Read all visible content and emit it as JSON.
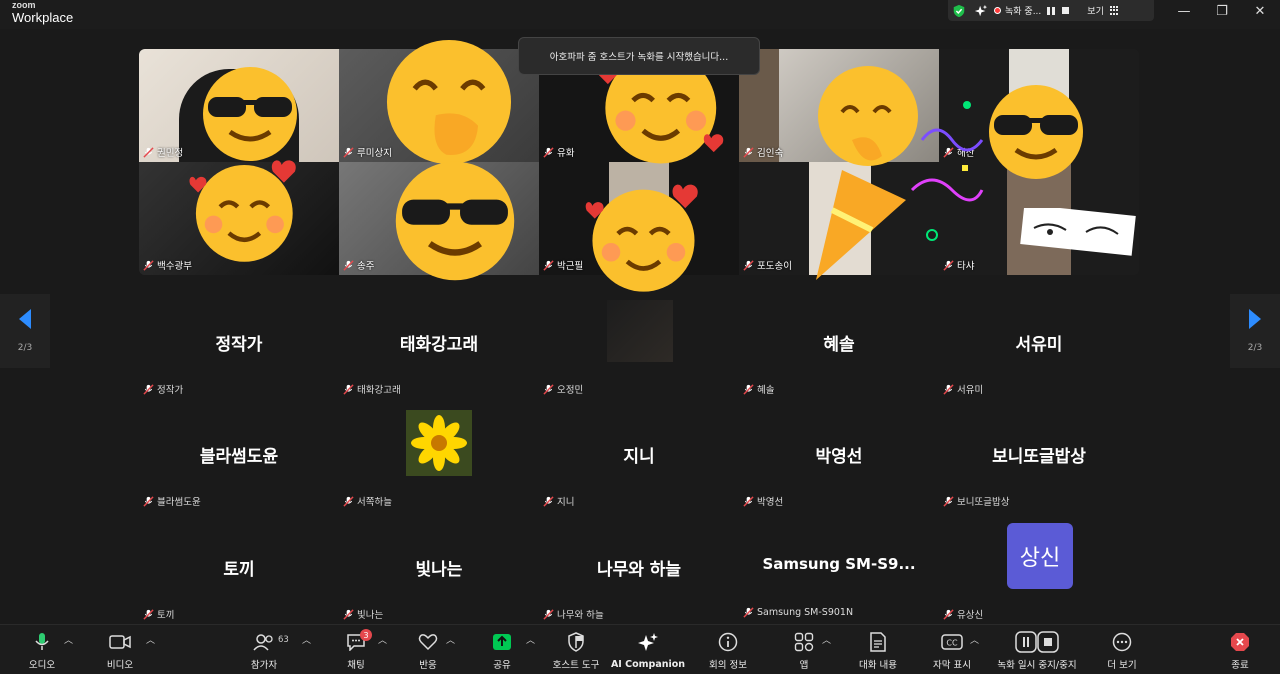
{
  "app": {
    "brand_small": "zoom",
    "brand_large": "Workplace"
  },
  "top_controls": {
    "recording_label": "녹화 중...",
    "view_label": "보기"
  },
  "window": {
    "minimize": "—",
    "maximize": "❐",
    "close": "✕"
  },
  "toast": {
    "text": "아호파파 줌 호스트가 녹화를 시작했습니다..."
  },
  "strip": {
    "tiles": [
      {
        "name": "권민정"
      },
      {
        "name": "루미상지"
      },
      {
        "name": "유화"
      },
      {
        "name": "김인숙"
      },
      {
        "name": "해산"
      },
      {
        "name": "백수광부"
      },
      {
        "name": "송주"
      },
      {
        "name": "박근필"
      },
      {
        "name": "포도송이"
      },
      {
        "name": "타샤"
      }
    ]
  },
  "pager": {
    "left_page": "2/3",
    "right_page": "2/3"
  },
  "grid": {
    "rows": [
      [
        {
          "display": "정작가",
          "name": "정작가"
        },
        {
          "display": "태화강고래",
          "name": "태화강고래"
        },
        {
          "display": "",
          "name": "오정민"
        },
        {
          "display": "혜솔",
          "name": "혜솔"
        },
        {
          "display": "서유미",
          "name": "서유미"
        }
      ],
      [
        {
          "display": "블라썸도윤",
          "name": "블라썸도윤"
        },
        {
          "display": "",
          "name": "서쪽하늘"
        },
        {
          "display": "지니",
          "name": "지니"
        },
        {
          "display": "박영선",
          "name": "박영선"
        },
        {
          "display": "보니또글밥상",
          "name": "보니또글밥상"
        }
      ],
      [
        {
          "display": "토끼",
          "name": "토끼"
        },
        {
          "display": "빛나는",
          "name": "빛나는"
        },
        {
          "display": "나무와 하늘",
          "name": "나무와 하늘"
        },
        {
          "display": "Samsung  SM-S9...",
          "name": "Samsung SM-S901N"
        },
        {
          "display": "",
          "name": "유상신"
        }
      ]
    ],
    "avatar_text": "상신"
  },
  "toolbar": {
    "audio": "오디오",
    "video": "비디오",
    "participants": "참가자",
    "participants_count": "63",
    "chat": "채팅",
    "chat_badge": "3",
    "reactions": "반응",
    "share": "공유",
    "host_tools": "호스트 도구",
    "ai_companion": "AI Companion",
    "meeting_info": "회의 정보",
    "apps": "앱",
    "transcript": "대화 내용",
    "captions": "자막 표시",
    "recording": "녹화 일시 중지/중지",
    "more": "더 보기",
    "end": "종료"
  },
  "colors": {
    "share_green": "#00c853",
    "end_red": "#e5484d",
    "avatar_purple": "#5b5bd6",
    "pager_blue": "#2d8cff"
  }
}
